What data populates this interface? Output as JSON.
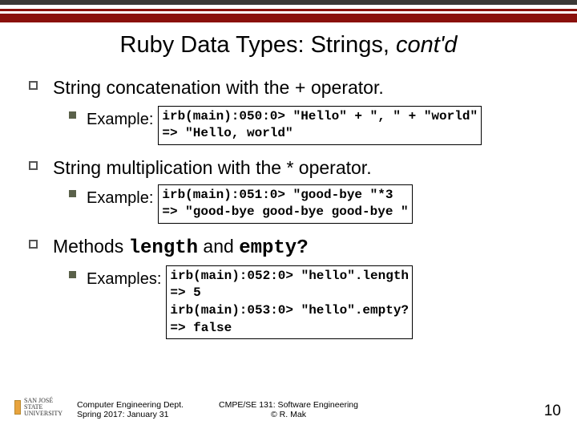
{
  "title_main": "Ruby Data Types: Strings, ",
  "title_contd": "cont'd",
  "bullets": {
    "concat": {
      "text_pre": "String concatenation with the ",
      "plus": "+",
      "text_post": " operator.",
      "example_label": "Example:",
      "code": "irb(main):050:0> \"Hello\" + \", \" + \"world\"\n=> \"Hello, world\""
    },
    "mult": {
      "text": "String multiplication with the * operator.",
      "example_label": "Example:",
      "code": "irb(main):051:0> \"good-bye \"*3\n=> \"good-bye good-bye good-bye \""
    },
    "methods": {
      "pre": "Methods ",
      "m1": "length",
      "and": " and ",
      "m2": "empty?",
      "examples_label": "Examples:",
      "code": "irb(main):052:0> \"hello\".length\n=> 5\nirb(main):053:0> \"hello\".empty?\n=> false"
    }
  },
  "footer": {
    "left_l1": "Computer Engineering Dept.",
    "left_l2": "Spring 2017: January 31",
    "mid_l1": "CMPE/SE 131: Software Engineering",
    "mid_l2": "© R. Mak",
    "page": "10"
  },
  "logo": {
    "line1": "SAN JOSÉ STATE",
    "line2": "UNIVERSITY"
  }
}
